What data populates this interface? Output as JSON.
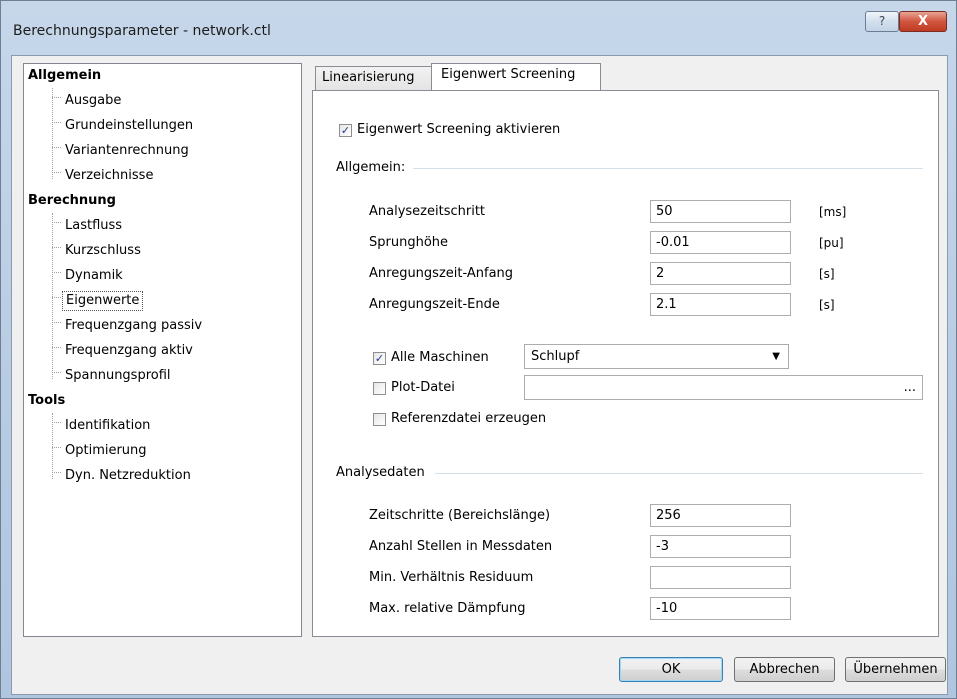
{
  "window": {
    "title": "Berechnungsparameter - network.ctl",
    "help_glyph": "?",
    "close_glyph": "X"
  },
  "tree": {
    "categories": [
      {
        "label": "Allgemein",
        "items": [
          "Ausgabe",
          "Grundeinstellungen",
          "Variantenrechnung",
          "Verzeichnisse"
        ]
      },
      {
        "label": "Berechnung",
        "items": [
          "Lastfluss",
          "Kurzschluss",
          "Dynamik",
          "Eigenwerte",
          "Frequenzgang passiv",
          "Frequenzgang aktiv",
          "Spannungsprofil"
        ]
      },
      {
        "label": "Tools",
        "items": [
          "Identifikation",
          "Optimierung",
          "Dyn. Netzreduktion"
        ]
      }
    ],
    "selected": "Eigenwerte"
  },
  "tabs": {
    "items": [
      "Linearisierung",
      "Eigenwert Screening"
    ],
    "active": "Eigenwert Screening"
  },
  "screening": {
    "enable_label": "Eigenwert Screening aktivieren",
    "enable_checked": true,
    "check_glyph": "✓",
    "allgemein_title": "Allgemein:",
    "params": [
      {
        "label": "Analysezeitschritt",
        "value": "50",
        "unit": "[ms]"
      },
      {
        "label": "Sprunghöhe",
        "value": "-0.01",
        "unit": "[pu]"
      },
      {
        "label": "Anregungszeit-Anfang",
        "value": "2",
        "unit": "[s]"
      },
      {
        "label": "Anregungszeit-Ende",
        "value": "2.1",
        "unit": "[s]"
      }
    ],
    "alle_maschinen": {
      "label": "Alle Maschinen",
      "checked": true,
      "select_value": "Schlupf",
      "arrow": "▼"
    },
    "plot_datei": {
      "label": "Plot-Datei",
      "checked": false,
      "value": "",
      "browse": "..."
    },
    "referenzdatei": {
      "label": "Referenzdatei erzeugen",
      "checked": false
    },
    "analysedaten_title": "Analysedaten",
    "analysedaten": [
      {
        "label": "Zeitschritte (Bereichslänge)",
        "value": "256"
      },
      {
        "label": "Anzahl Stellen in Messdaten",
        "value": "-3"
      },
      {
        "label": "Min. Verhältnis Residuum",
        "value": ""
      },
      {
        "label": "Max. relative Dämpfung",
        "value": "-10"
      }
    ]
  },
  "buttons": {
    "ok": "OK",
    "cancel": "Abbrechen",
    "apply": "Übernehmen"
  }
}
